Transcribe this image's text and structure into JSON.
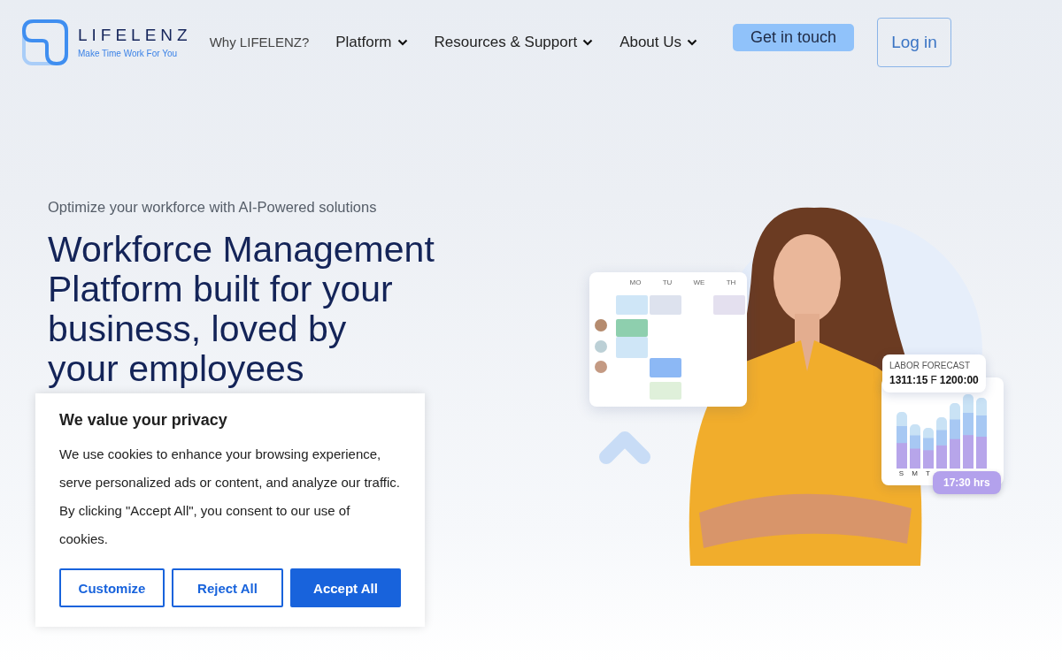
{
  "header": {
    "logo": {
      "name": "LIFELENZ",
      "tagline": "Make Time Work For You"
    },
    "nav": [
      {
        "label": "Why LIFELENZ?",
        "dropdown": false
      },
      {
        "label": "Platform",
        "dropdown": true
      },
      {
        "label": "Resources & Support",
        "dropdown": true
      },
      {
        "label": "About Us",
        "dropdown": true
      }
    ],
    "contact_button": "Get in touch",
    "login_button": "Log in"
  },
  "hero": {
    "eyebrow": "Optimize your workforce with AI-Powered solutions",
    "headline_lines": [
      "Workforce Management",
      "Platform built for your",
      "business, loved by",
      "your employees"
    ]
  },
  "schedule_card": {
    "days": [
      "MO",
      "TU",
      "WE",
      "TH"
    ]
  },
  "forecast_card": {
    "title": "LABOR FORECAST",
    "actual": "1311:15",
    "forecast_label": "F",
    "forecast": "1200:00",
    "days": [
      "S",
      "M",
      "T"
    ],
    "total": "17:30 hrs"
  },
  "cookie_banner": {
    "title": "We value your privacy",
    "text": "We use cookies to enhance your browsing experience, serve personalized ads or content, and analyze our traffic. By clicking \"Accept All\", you consent to our use of cookies.",
    "buttons": [
      {
        "label": "Customize",
        "kind": "outline"
      },
      {
        "label": "Reject All",
        "kind": "outline"
      },
      {
        "label": "Accept All",
        "kind": "primary"
      }
    ]
  }
}
